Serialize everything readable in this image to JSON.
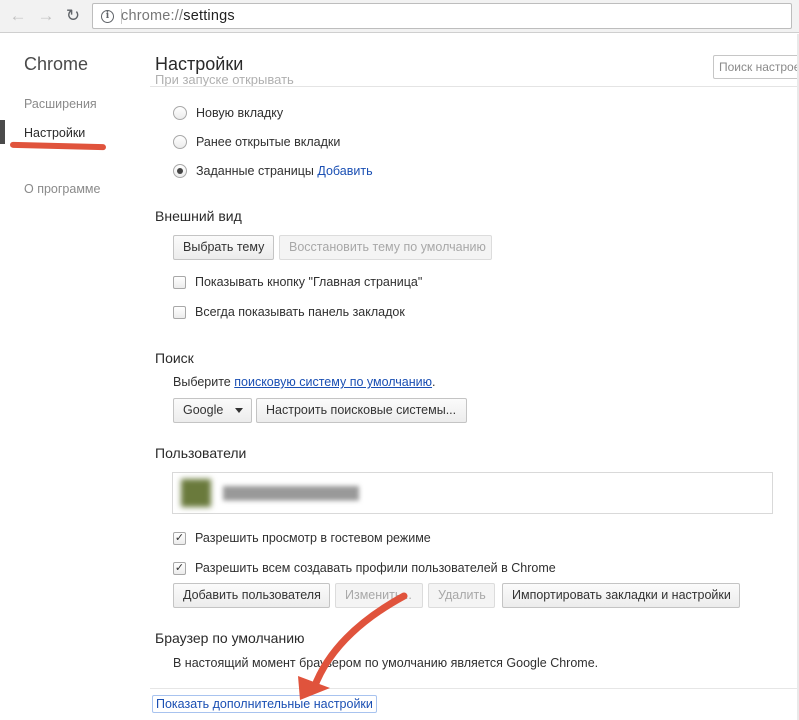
{
  "browser": {
    "url_scheme": "chrome://",
    "url_path": "settings"
  },
  "sidebar": {
    "brand": "Chrome",
    "items": [
      {
        "label": "Расширения"
      },
      {
        "label": "Настройки"
      },
      {
        "label": "О программе"
      }
    ]
  },
  "header": {
    "title": "Настройки",
    "search_placeholder": "Поиск настроек",
    "partial_heading": "При запуске открывать"
  },
  "startup": {
    "options": [
      {
        "label": "Новую вкладку",
        "checked": false
      },
      {
        "label": "Ранее открытые вкладки",
        "checked": false
      },
      {
        "label": "Заданные страницы",
        "checked": true
      }
    ],
    "add_link": "Добавить"
  },
  "appearance": {
    "title": "Внешний вид",
    "choose_theme": "Выбрать тему",
    "reset_theme": "Восстановить тему по умолчанию",
    "show_home": "Показывать кнопку \"Главная страница\"",
    "show_bookmarks": "Всегда показывать панель закладок"
  },
  "search": {
    "title": "Поиск",
    "prefix": "Выберите ",
    "link": "поисковую систему по умолчанию",
    "suffix": ".",
    "engine": "Google",
    "manage": "Настроить поисковые системы..."
  },
  "users": {
    "title": "Пользователи",
    "guest": "Разрешить просмотр в гостевом режиме",
    "allow_profiles": "Разрешить всем создавать профили пользователей в Chrome",
    "add": "Добавить пользователя",
    "edit": "Изменить...",
    "delete": "Удалить",
    "import": "Импортировать закладки и настройки"
  },
  "default_browser": {
    "title": "Браузер по умолчанию",
    "status": "В настоящий момент браузером по умолчанию является Google Chrome."
  },
  "advanced_link": "Показать дополнительные настройки",
  "colors": {
    "annotation_red": "#e0533c",
    "link_blue": "#1a4fb3"
  }
}
